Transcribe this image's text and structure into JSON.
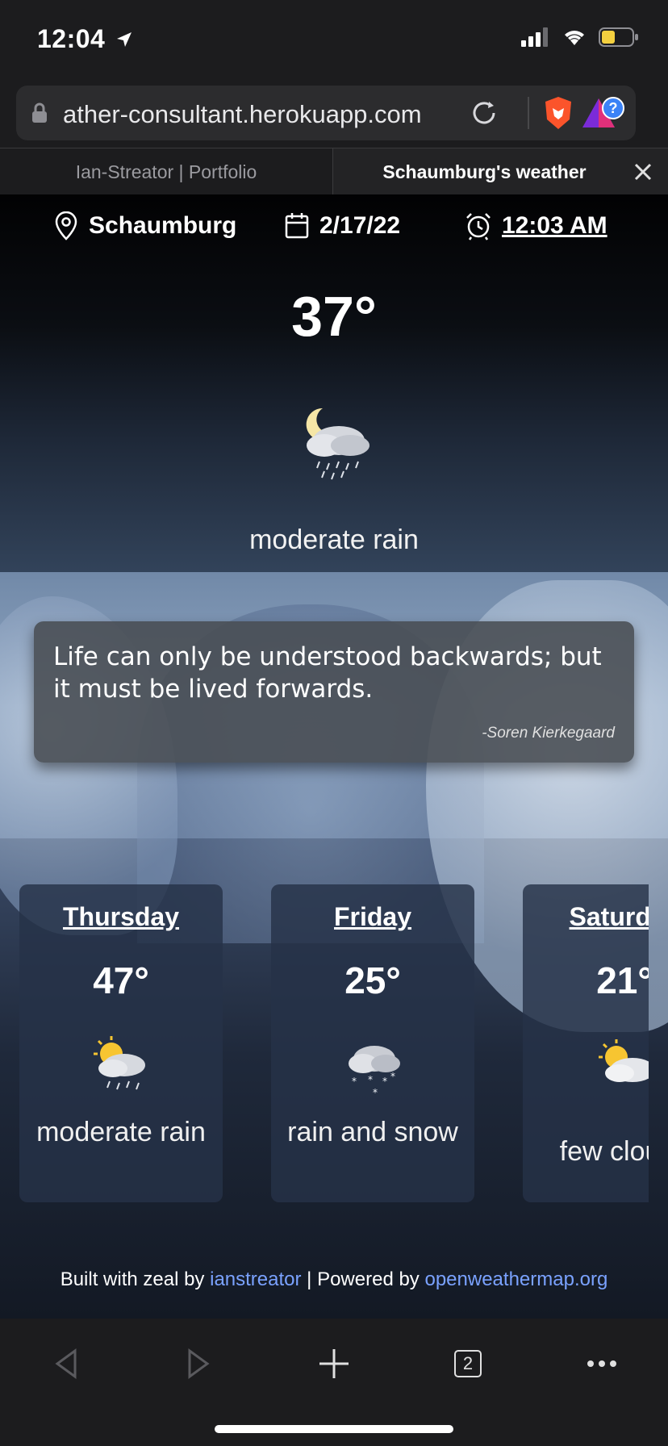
{
  "status_bar": {
    "time": "12:04"
  },
  "browser": {
    "url": "ather-consultant.herokuapp.com",
    "tabs": [
      {
        "label": "Ian-Streator | Portfolio"
      },
      {
        "label": "Schaumburg's weather"
      }
    ],
    "tab_count": "2"
  },
  "weather": {
    "location": "Schaumburg",
    "date": "2/17/22",
    "time": "12:03 AM",
    "current": {
      "temp": "37°",
      "description": "moderate rain",
      "icon": "night-rain-cloud-icon"
    },
    "forecast": [
      {
        "day": "Thursday",
        "temp": "47°",
        "description": "moderate rain",
        "icon": "sun-rain-cloud-icon"
      },
      {
        "day": "Friday",
        "temp": "25°",
        "description": "rain and snow",
        "icon": "snow-cloud-icon"
      },
      {
        "day": "Saturday",
        "temp": "21°",
        "description": "few clouds",
        "icon": "sun-cloud-icon"
      }
    ]
  },
  "quote": {
    "text": "Life can only be understood backwards; but it must be lived forwards.",
    "author": "-Soren Kierkegaard"
  },
  "footer": {
    "prefix": "Built with zeal by ",
    "author_link": "ianstreator",
    "separator": " | Powered by ",
    "api_link": "openweathermap.org"
  },
  "colors": {
    "link": "#7aa2ff",
    "brave": "#fb542b",
    "battery": "#f4d03f"
  }
}
